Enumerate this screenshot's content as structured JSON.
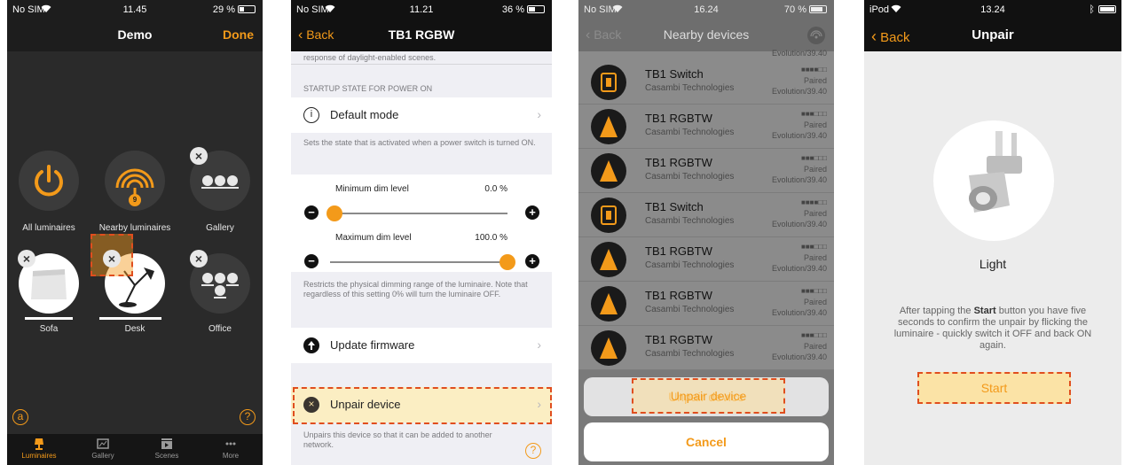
{
  "accent": "#f39a1a",
  "highlight": "#e04e1e",
  "phone1": {
    "status": {
      "carrier": "No SIM",
      "time": "11.45",
      "battery": "29 %"
    },
    "title": "Demo",
    "done": "Done",
    "tiles": [
      {
        "label": "All luminaires",
        "icon": "power-icon"
      },
      {
        "label": "Nearby luminaires",
        "icon": "signal-icon",
        "badge": "9"
      },
      {
        "label": "Gallery",
        "icon": "lamps-icon"
      },
      {
        "label": "Sofa",
        "icon": "lampshade-icon"
      },
      {
        "label": "Desk",
        "icon": "desk-lamp-icon"
      },
      {
        "label": "Office",
        "icon": "lamps-icon"
      }
    ],
    "tabs": [
      "Luminaires",
      "Gallery",
      "Scenes",
      "More"
    ]
  },
  "phone2": {
    "status": {
      "carrier": "No SIM",
      "time": "11.21",
      "battery": "36 %"
    },
    "back": "Back",
    "title": "TB1 RGBW",
    "top_note": "response of daylight-enabled scenes.",
    "section": "STARTUP STATE FOR POWER ON",
    "default_mode": "Default mode",
    "default_note": "Sets the state that is activated when a power switch is turned ON.",
    "min_label": "Minimum dim level",
    "min_value": "0.0 %",
    "min_fraction": 0.0,
    "max_label": "Maximum dim level",
    "max_value": "100.0 %",
    "max_fraction": 1.0,
    "range_note": "Restricts the physical dimming range of the luminaire. Note that regardless of this setting 0% will turn the luminaire OFF.",
    "update": "Update firmware",
    "unpair": "Unpair device",
    "unpair_note": "Unpairs this device so that it can be added to another network."
  },
  "phone3": {
    "status": {
      "carrier": "No SIM",
      "time": "16.24",
      "battery": "70 %"
    },
    "back": "Back",
    "title": "Nearby devices",
    "top_partial": "Evolution/39.40",
    "devices": [
      {
        "name": "TB1 Switch",
        "vendor": "Casambi Technologies",
        "status": "Paired",
        "version": "Evolution/39.40",
        "signal": "■■■■□□",
        "kind": "switch"
      },
      {
        "name": "TB1 RGBTW",
        "vendor": "Casambi Technologies",
        "status": "Paired",
        "version": "Evolution/39.40",
        "signal": "■■■□□□",
        "kind": "light"
      },
      {
        "name": "TB1 RGBTW",
        "vendor": "Casambi Technologies",
        "status": "Paired",
        "version": "Evolution/39.40",
        "signal": "■■■□□□",
        "kind": "light"
      },
      {
        "name": "TB1 Switch",
        "vendor": "Casambi Technologies",
        "status": "Paired",
        "version": "Evolution/39.40",
        "signal": "■■■■□□",
        "kind": "switch"
      },
      {
        "name": "TB1 RGBTW",
        "vendor": "Casambi Technologies",
        "status": "Paired",
        "version": "Evolution/39.40",
        "signal": "■■■□□□",
        "kind": "light"
      },
      {
        "name": "TB1 RGBTW",
        "vendor": "Casambi Technologies",
        "status": "Paired",
        "version": "Evolution/39.40",
        "signal": "■■■□□□",
        "kind": "light"
      },
      {
        "name": "TB1 RGBTW",
        "vendor": "Casambi Technologies",
        "status": "Paired",
        "version": "Evolution/39.40",
        "signal": "■■■□□□",
        "kind": "light"
      }
    ],
    "sheet_unpair": "Unpair device",
    "sheet_cancel": "Cancel"
  },
  "phone4": {
    "status": {
      "carrier": "iPod",
      "time": "13.24"
    },
    "back": "Back",
    "title": "Unpair",
    "device_name": "Light",
    "instruction_pre": "After tapping the ",
    "instruction_bold": "Start",
    "instruction_post": " button you have five seconds to confirm the unpair by flicking the luminaire - quickly switch it OFF and back ON again.",
    "start": "Start"
  }
}
